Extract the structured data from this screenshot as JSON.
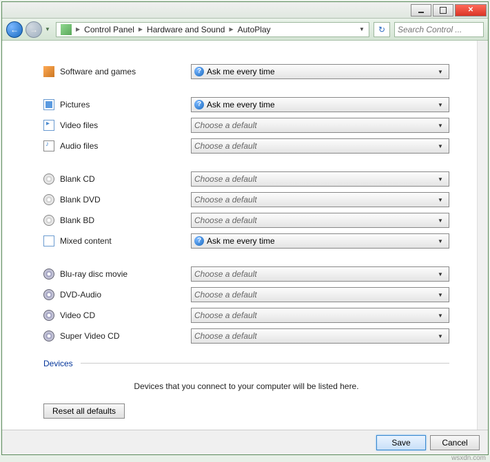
{
  "title_hint": "",
  "breadcrumb": {
    "root": "Control Panel",
    "mid": "Hardware and Sound",
    "leaf": "AutoPlay"
  },
  "search": {
    "placeholder": "Search Control ..."
  },
  "options": {
    "ask": "Ask me every time",
    "choose": "Choose a default"
  },
  "rows": {
    "software": "Software and games",
    "pictures": "Pictures",
    "video": "Video files",
    "audio": "Audio files",
    "blank_cd": "Blank CD",
    "blank_dvd": "Blank DVD",
    "blank_bd": "Blank BD",
    "mixed": "Mixed content",
    "bluray": "Blu-ray disc movie",
    "dvdaudio": "DVD-Audio",
    "vcd": "Video CD",
    "svcd": "Super Video CD"
  },
  "devices": {
    "title": "Devices",
    "note": "Devices that you connect to your computer will be listed here."
  },
  "reset": "Reset all defaults",
  "footer": {
    "save": "Save",
    "cancel": "Cancel"
  },
  "watermark": "wsxdn.com"
}
